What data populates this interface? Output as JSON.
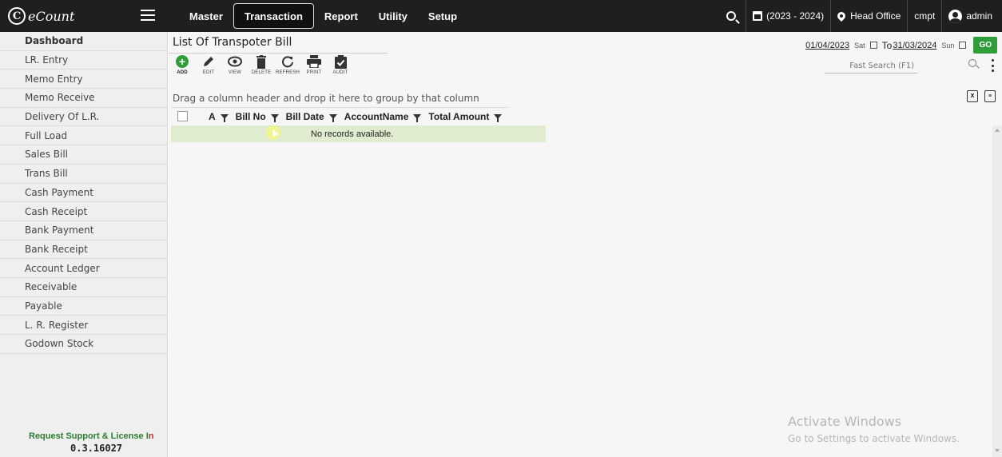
{
  "brand": {
    "mark": "C",
    "name": "eCount"
  },
  "nav": [
    {
      "label": "Master"
    },
    {
      "label": "Transaction"
    },
    {
      "label": "Report"
    },
    {
      "label": "Utility"
    },
    {
      "label": "Setup"
    }
  ],
  "topbar": {
    "year": "(2023 - 2024)",
    "branch": "Head Office",
    "company": "cmpt",
    "user": "admin"
  },
  "sidebar": {
    "items": [
      {
        "label": "Dashboard"
      },
      {
        "label": "LR. Entry"
      },
      {
        "label": "Memo Entry"
      },
      {
        "label": "Memo Receive"
      },
      {
        "label": "Delivery Of L.R."
      },
      {
        "label": "Full Load"
      },
      {
        "label": "Sales Bill"
      },
      {
        "label": "Trans Bill"
      },
      {
        "label": "Cash Payment"
      },
      {
        "label": "Cash Receipt"
      },
      {
        "label": "Bank Payment"
      },
      {
        "label": "Bank Receipt"
      },
      {
        "label": "Account Ledger"
      },
      {
        "label": "Receivable"
      },
      {
        "label": "Payable"
      },
      {
        "label": "L. R. Register"
      },
      {
        "label": "Godown Stock"
      }
    ],
    "support_green": "Request Support & License I",
    "support_red": "n",
    "version": "0.3.16027"
  },
  "page": {
    "title": "List Of Transpoter Bill",
    "toolbar": [
      {
        "label": "ADD",
        "icon": "plus-circle-icon"
      },
      {
        "label": "EDIT",
        "icon": "pencil-icon"
      },
      {
        "label": "VIEW",
        "icon": "eye-icon"
      },
      {
        "label": "DELETE",
        "icon": "trash-icon"
      },
      {
        "label": "REFRESH",
        "icon": "refresh-icon"
      },
      {
        "label": "PRINT",
        "icon": "printer-icon"
      },
      {
        "label": "AUDIT",
        "icon": "clipboard-check-icon"
      }
    ],
    "date_from": "01/04/2023",
    "day_from": "Sat",
    "to_label": "To",
    "date_to": "31/03/2024",
    "day_to": "Sun",
    "go_label": "GO",
    "search_placeholder": "Fast Search (F1)",
    "group_hint": "Drag a column header and drop it here to group by that column",
    "columns": [
      {
        "label": "A"
      },
      {
        "label": "Bill No"
      },
      {
        "label": "Bill Date"
      },
      {
        "label": "AccountName"
      },
      {
        "label": "Total Amount"
      }
    ],
    "empty_message": "No records available."
  },
  "watermark": {
    "line1": "Activate Windows",
    "line2": "Go to Settings to activate Windows."
  },
  "colors": {
    "topbar": "#1f1f1f",
    "accent_green": "#2e9d3a",
    "empty_row": "#dfeccf"
  }
}
